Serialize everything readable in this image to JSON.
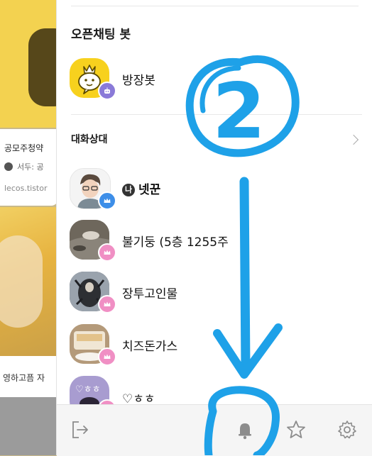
{
  "background_chat": {
    "card_title": "공모주청약 ",
    "card_author": "서두: 공",
    "card_url": "lecos.tistor",
    "photo_caption": "영하고픔 자"
  },
  "openchat_bot": {
    "section_title": "오픈채팅 봇",
    "bot_name": "방장봇"
  },
  "partners": {
    "section_title": "대화상대",
    "items": [
      {
        "name": "넷꾼",
        "me_tag": "나",
        "badge": "host"
      },
      {
        "name": "불기둥 (5층 1255주",
        "badge": "sub-host"
      },
      {
        "name": "장투고인물",
        "badge": "sub-host"
      },
      {
        "name": "치즈돈가스",
        "badge": "sub-host"
      },
      {
        "name": "♡ㅎㅎ",
        "avatar_text": "♡ㅎㅎ",
        "badge": "sub-host"
      }
    ]
  },
  "toolbar": {
    "icons": [
      "exit-icon",
      "bell-icon",
      "star-icon",
      "settings-icon"
    ]
  },
  "annotation": {
    "number_label": "2",
    "color": "#1ea1e8"
  },
  "colors": {
    "host_badge": "#3d8ee8",
    "subhost_badge": "#f08fc4",
    "bot_badge": "#8a7ad8",
    "bot_avatar_bg": "#f7d11e"
  }
}
